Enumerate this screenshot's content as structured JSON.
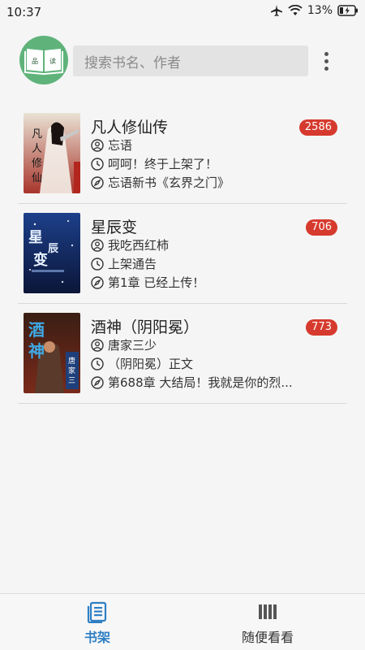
{
  "status_bar": {
    "time": "10:37",
    "battery": "13%",
    "icons": [
      "airplane-icon",
      "wifi-icon",
      "battery-icon"
    ]
  },
  "header": {
    "logo_text_left": "品",
    "logo_text_right": "读",
    "search_placeholder": "搜索书名、作者",
    "menu_icon": "more-vert-icon"
  },
  "books": [
    {
      "title": "凡人修仙传",
      "count": "2586",
      "author": "忘语",
      "latest": "呵呵！终于上架了！",
      "update": "忘语新书《玄界之门》",
      "cover_text": "凡人修仙传"
    },
    {
      "title": "星辰变",
      "count": "706",
      "author": "我吃西红柿",
      "latest": "上架通告",
      "update": "第1章 已经上传！",
      "cover_text": "星辰变"
    },
    {
      "title": "酒神（阴阳冕）",
      "count": "773",
      "author": "唐家三少",
      "latest": "（阴阳冕）正文",
      "update": "第688章 大结局！我就是你的烈...",
      "cover_text": "酒神"
    }
  ],
  "bottom_nav": {
    "shelf_label": "书架",
    "random_label": "随便看看"
  },
  "colors": {
    "accent": "#2f7fc4",
    "badge": "#d63a2e",
    "logo_bg": "#5fb37a"
  }
}
